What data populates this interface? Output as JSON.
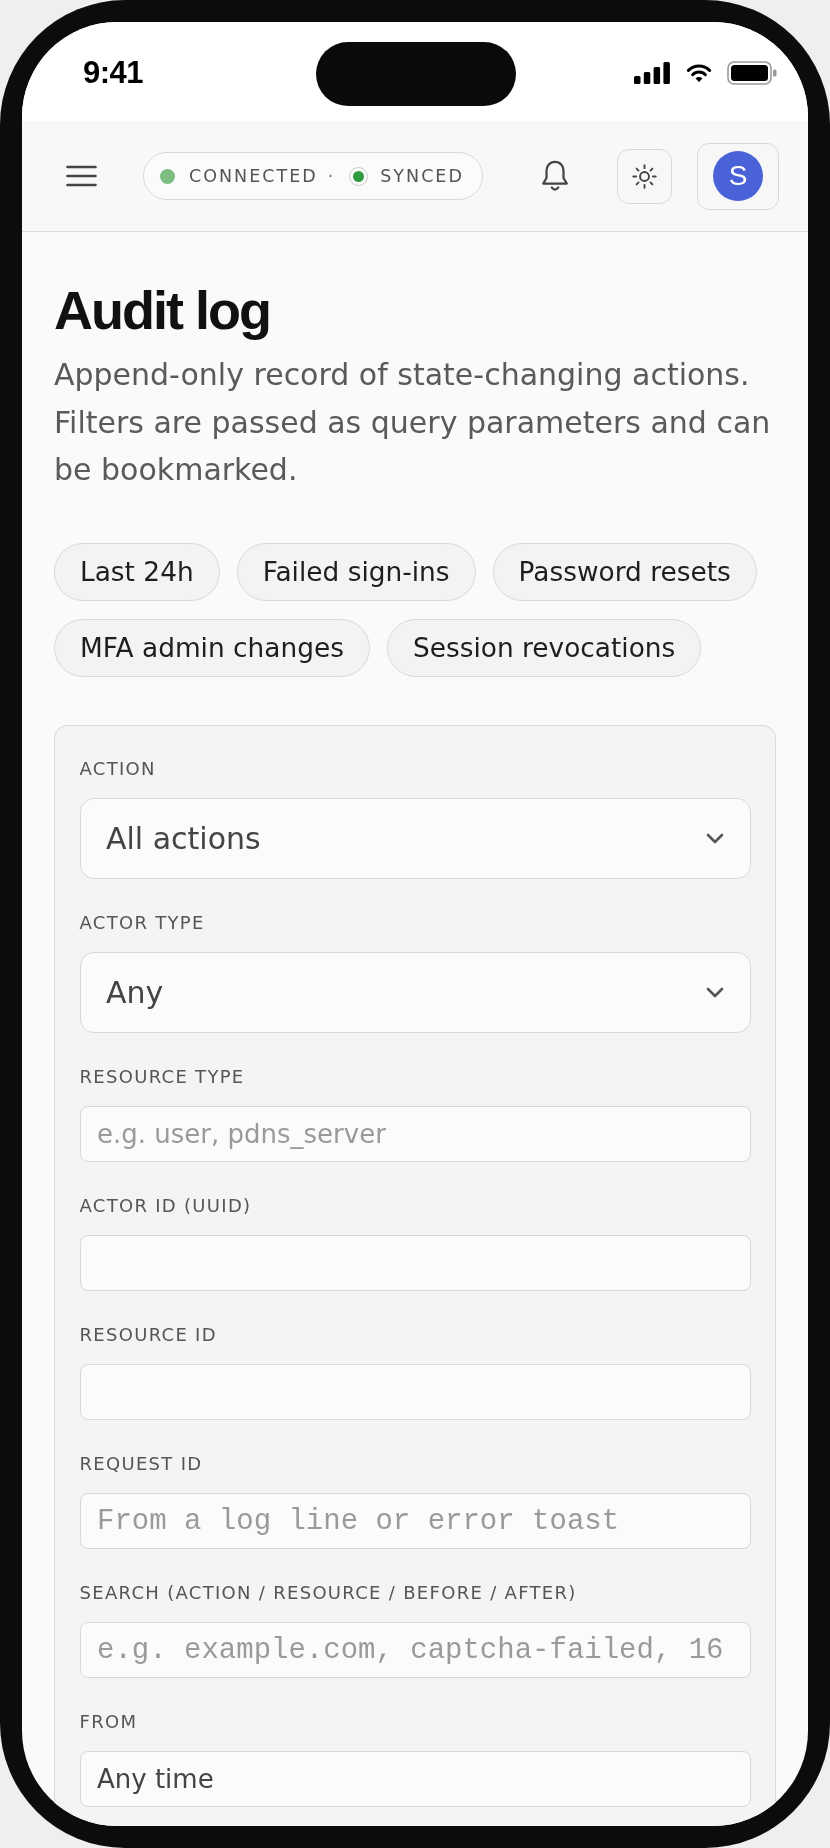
{
  "status_bar": {
    "time": "9:41"
  },
  "header": {
    "connection": {
      "items": [
        {
          "kind": "plain",
          "label": "CONNECTED",
          "color": "#7cbd80"
        },
        {
          "kind": "ring",
          "label": "SYNCED",
          "color": "#2f9c3f"
        }
      ],
      "separator": "·"
    },
    "account": {
      "initial": "S"
    }
  },
  "page": {
    "title": "Audit log",
    "subtitle": "Append-only record of state-changing actions. Filters are passed as query parameters and can be bookmarked."
  },
  "presets": [
    "Last 24h",
    "Failed sign-ins",
    "Password resets",
    "MFA admin changes",
    "Session revocations"
  ],
  "filters": [
    {
      "kind": "select",
      "label": "ACTION",
      "value": "All actions"
    },
    {
      "kind": "select",
      "label": "ACTOR TYPE",
      "value": "Any"
    },
    {
      "kind": "text",
      "label": "RESOURCE TYPE",
      "placeholder": "e.g. user, pdns_server"
    },
    {
      "kind": "text",
      "label": "ACTOR ID (UUID)"
    },
    {
      "kind": "text",
      "label": "RESOURCE ID"
    },
    {
      "kind": "mono",
      "label": "REQUEST ID",
      "placeholder": "From a log line or error toast"
    },
    {
      "kind": "mono",
      "label": "SEARCH (ACTION / RESOURCE / BEFORE / AFTER)",
      "placeholder": "e.g. example.com, captcha-failed, 16"
    },
    {
      "kind": "text",
      "label": "FROM",
      "value": "Any time"
    }
  ]
}
